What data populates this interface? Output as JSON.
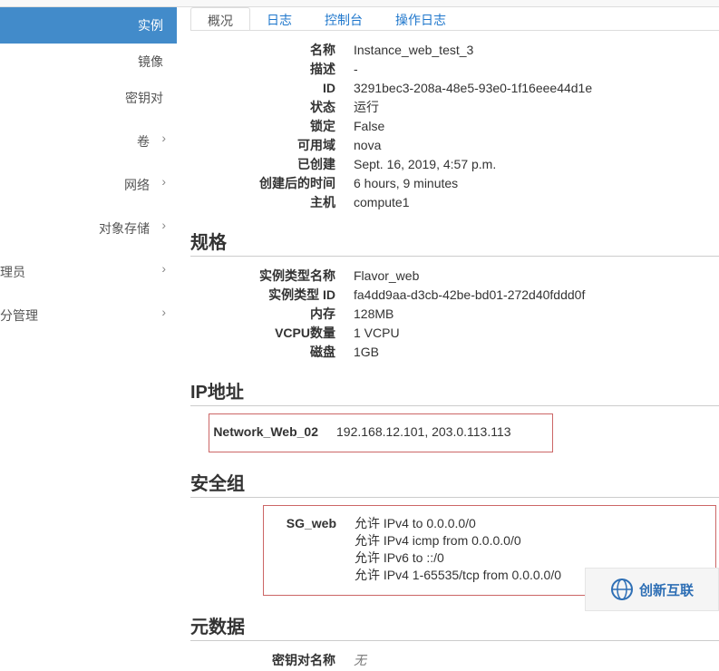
{
  "sidebar": {
    "items": [
      {
        "label": "实例",
        "active": true
      },
      {
        "label": "镜像"
      },
      {
        "label": "密钥对"
      },
      {
        "label": "卷",
        "arrow": true
      },
      {
        "label": "网络",
        "arrow": true
      },
      {
        "label": "对象存储",
        "arrow": true
      },
      {
        "label": "理员",
        "arrow": true
      },
      {
        "label": "分管理",
        "arrow": true
      }
    ]
  },
  "tabs": [
    {
      "label": "概况",
      "active": true
    },
    {
      "label": "日志"
    },
    {
      "label": "控制台"
    },
    {
      "label": "操作日志"
    }
  ],
  "overview": {
    "name_label": "名称",
    "name": "Instance_web_test_3",
    "desc_label": "描述",
    "desc": "-",
    "id_label": "ID",
    "id": "3291bec3-208a-48e5-93e0-1f16eee44d1e",
    "status_label": "状态",
    "status": "运行",
    "locked_label": "锁定",
    "locked": "False",
    "az_label": "可用域",
    "az": "nova",
    "created_label": "已创建",
    "created": "Sept. 16, 2019, 4:57 p.m.",
    "uptime_label": "创建后的时间",
    "uptime": "6 hours, 9 minutes",
    "host_label": "主机",
    "host": "compute1"
  },
  "spec": {
    "heading": "规格",
    "flavor_name_label": "实例类型名称",
    "flavor_name": "Flavor_web",
    "flavor_id_label": "实例类型 ID",
    "flavor_id": "fa4dd9aa-d3cb-42be-bd01-272d40fddd0f",
    "ram_label": "内存",
    "ram": "128MB",
    "vcpu_label": "VCPU数量",
    "vcpu": "1 VCPU",
    "disk_label": "磁盘",
    "disk": "1GB"
  },
  "ip": {
    "heading": "IP地址",
    "network_label": "Network_Web_02",
    "addresses": "192.168.12.101, 203.0.113.113"
  },
  "secgroup": {
    "heading": "安全组",
    "group_label": "SG_web",
    "rules": [
      "允许 IPv4 to 0.0.0.0/0",
      "允许 IPv4 icmp from 0.0.0.0/0",
      "允许 IPv6 to ::/0",
      "允许 IPv4 1-65535/tcp from 0.0.0.0/0"
    ]
  },
  "metadata": {
    "heading": "元数据",
    "keypair_label": "密钥对名称",
    "keypair_value": "无"
  },
  "watermark": {
    "text": "创新互联"
  }
}
